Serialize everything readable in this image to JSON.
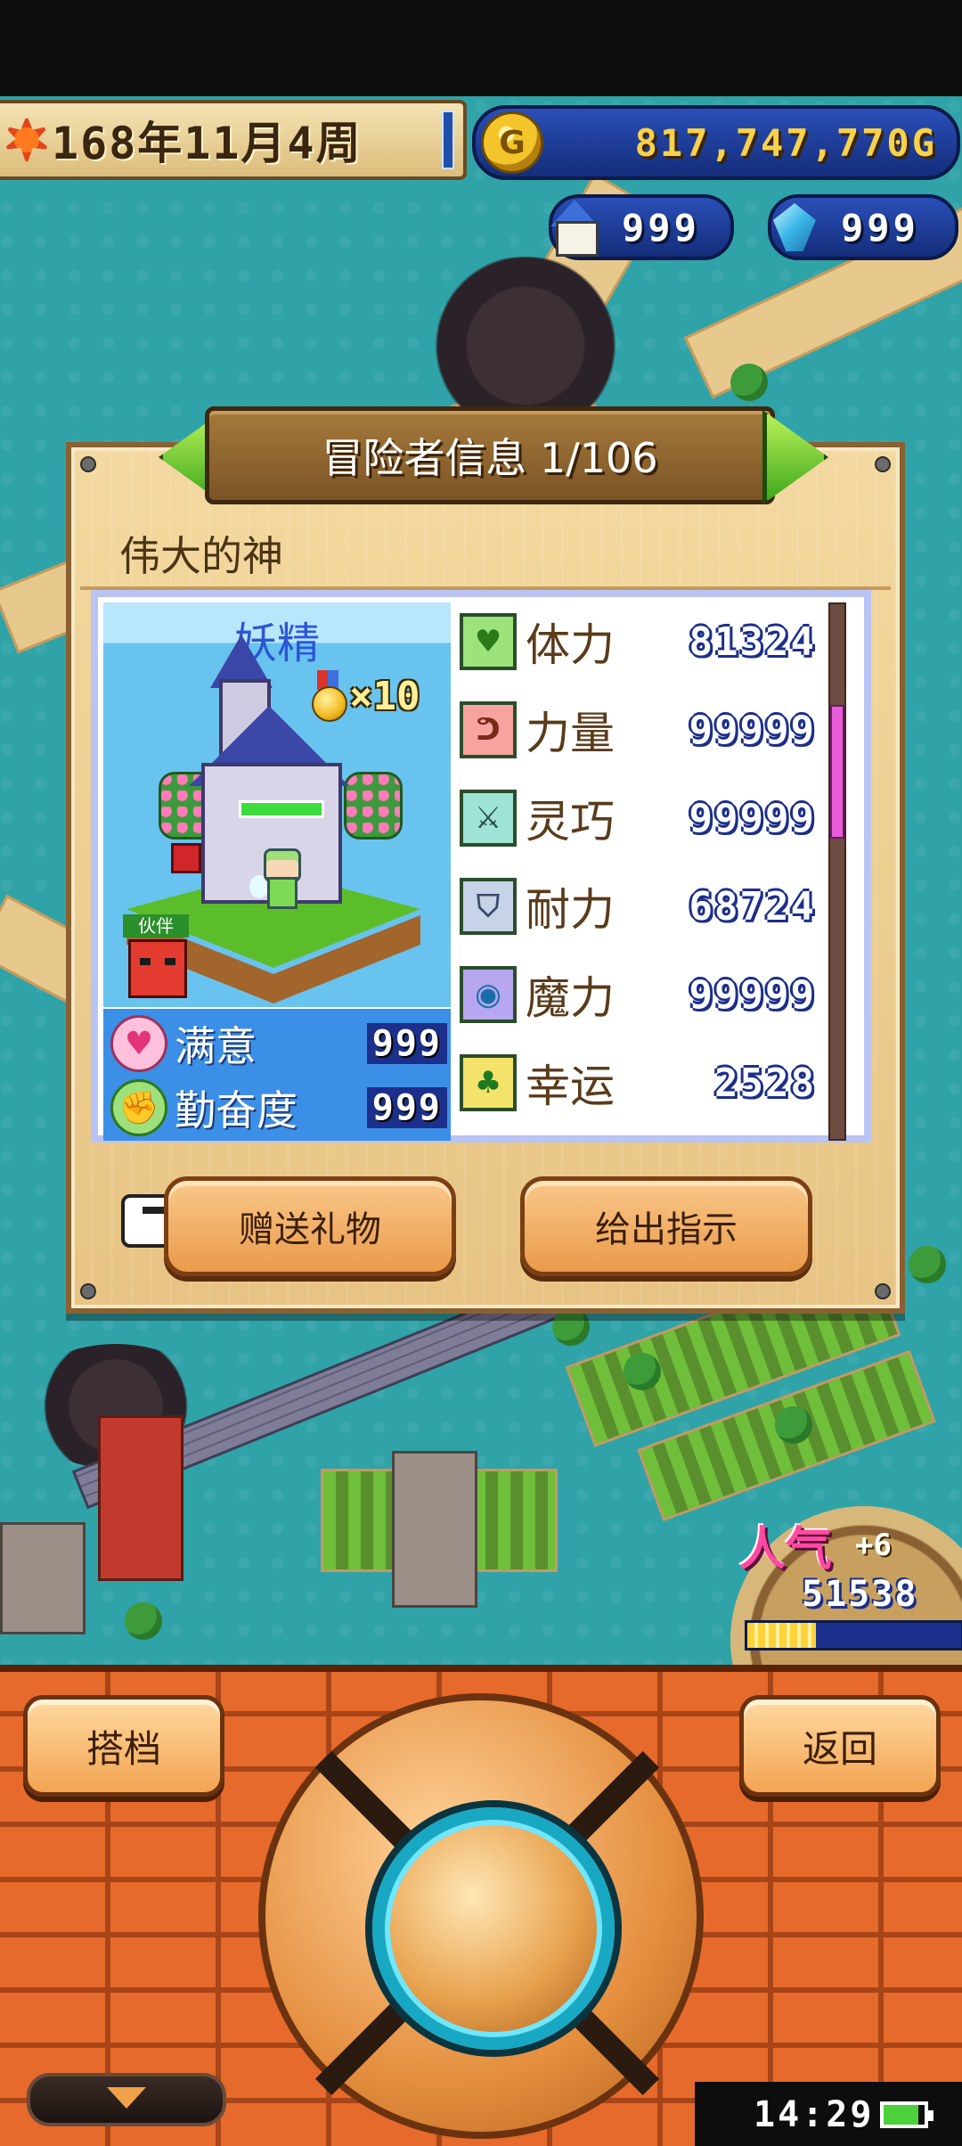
{
  "hud": {
    "date": "168年11月4周",
    "gold": "817,747,770G",
    "gold_coin_letter": "G",
    "houses": "999",
    "crystals": "999"
  },
  "dialog": {
    "title": "冒险者信息 1/106",
    "adventurer_name": "伟大的神",
    "class_name": "妖精",
    "medal_count": "×10",
    "partner_label": "伙伴",
    "hp_fraction": 1.0,
    "mood": [
      {
        "label": "满意",
        "value": "999",
        "icon": "heart-icon"
      },
      {
        "label": "勤奋度",
        "value": "999",
        "icon": "effort-icon"
      }
    ],
    "stats": [
      {
        "label": "体力",
        "value": "81324",
        "icon": "heart-icon",
        "color": "#9be37a"
      },
      {
        "label": "力量",
        "value": "99999",
        "icon": "muscle-icon",
        "color": "#f7a3a0"
      },
      {
        "label": "灵巧",
        "value": "99999",
        "icon": "crossed-swords-icon",
        "color": "#9fe3d6"
      },
      {
        "label": "耐力",
        "value": "68724",
        "icon": "shield-icon",
        "color": "#c7d3e8"
      },
      {
        "label": "魔力",
        "value": "99999",
        "icon": "magic-orb-icon",
        "color": "#b7a6f0"
      },
      {
        "label": "幸运",
        "value": "2528",
        "icon": "clover-icon",
        "color": "#f3e36a"
      }
    ],
    "scroll_position": 0.25,
    "buttons": {
      "gift": "赠送礼物",
      "instruct": "给出指示"
    }
  },
  "popularity": {
    "label": "人气",
    "rank": "+6",
    "value": "51538",
    "bar_fraction": 0.32
  },
  "controls": {
    "partner": "搭档",
    "back": "返回"
  },
  "status": {
    "time": "14:29",
    "battery_fraction": 0.85
  },
  "colors": {
    "panel_border": "#b9c4f4",
    "number_outline": "#1c2f8a",
    "scroll_thumb": "#e85cd9",
    "brick": "#e56a2b"
  }
}
